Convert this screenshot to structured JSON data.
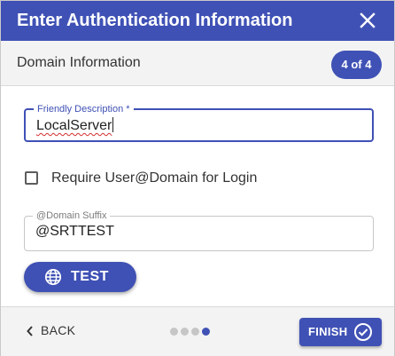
{
  "dialog": {
    "title": "Enter Authentication Information",
    "close_icon": "close-icon",
    "section_title": "Domain Information",
    "step_badge": "4 of 4"
  },
  "form": {
    "friendly_description": {
      "label": "Friendly Description *",
      "value": "LocalServer"
    },
    "require_user_domain": {
      "label": "Require User@Domain for Login",
      "checked": false
    },
    "domain_suffix": {
      "label": "@Domain Suffix",
      "value": "@SRTTEST"
    },
    "test_button": {
      "label": "TEST",
      "icon": "globe-icon"
    }
  },
  "footer": {
    "back_label": "BACK",
    "back_icon": "chevron-left-icon",
    "step_count": 4,
    "current_step": 4,
    "finish_label": "FINISH",
    "finish_icon": "check-circle-icon"
  },
  "colors": {
    "primary": "#3f51b5",
    "header_bg": "#f3f3f3",
    "inactive_dot": "#c6c6c6"
  }
}
